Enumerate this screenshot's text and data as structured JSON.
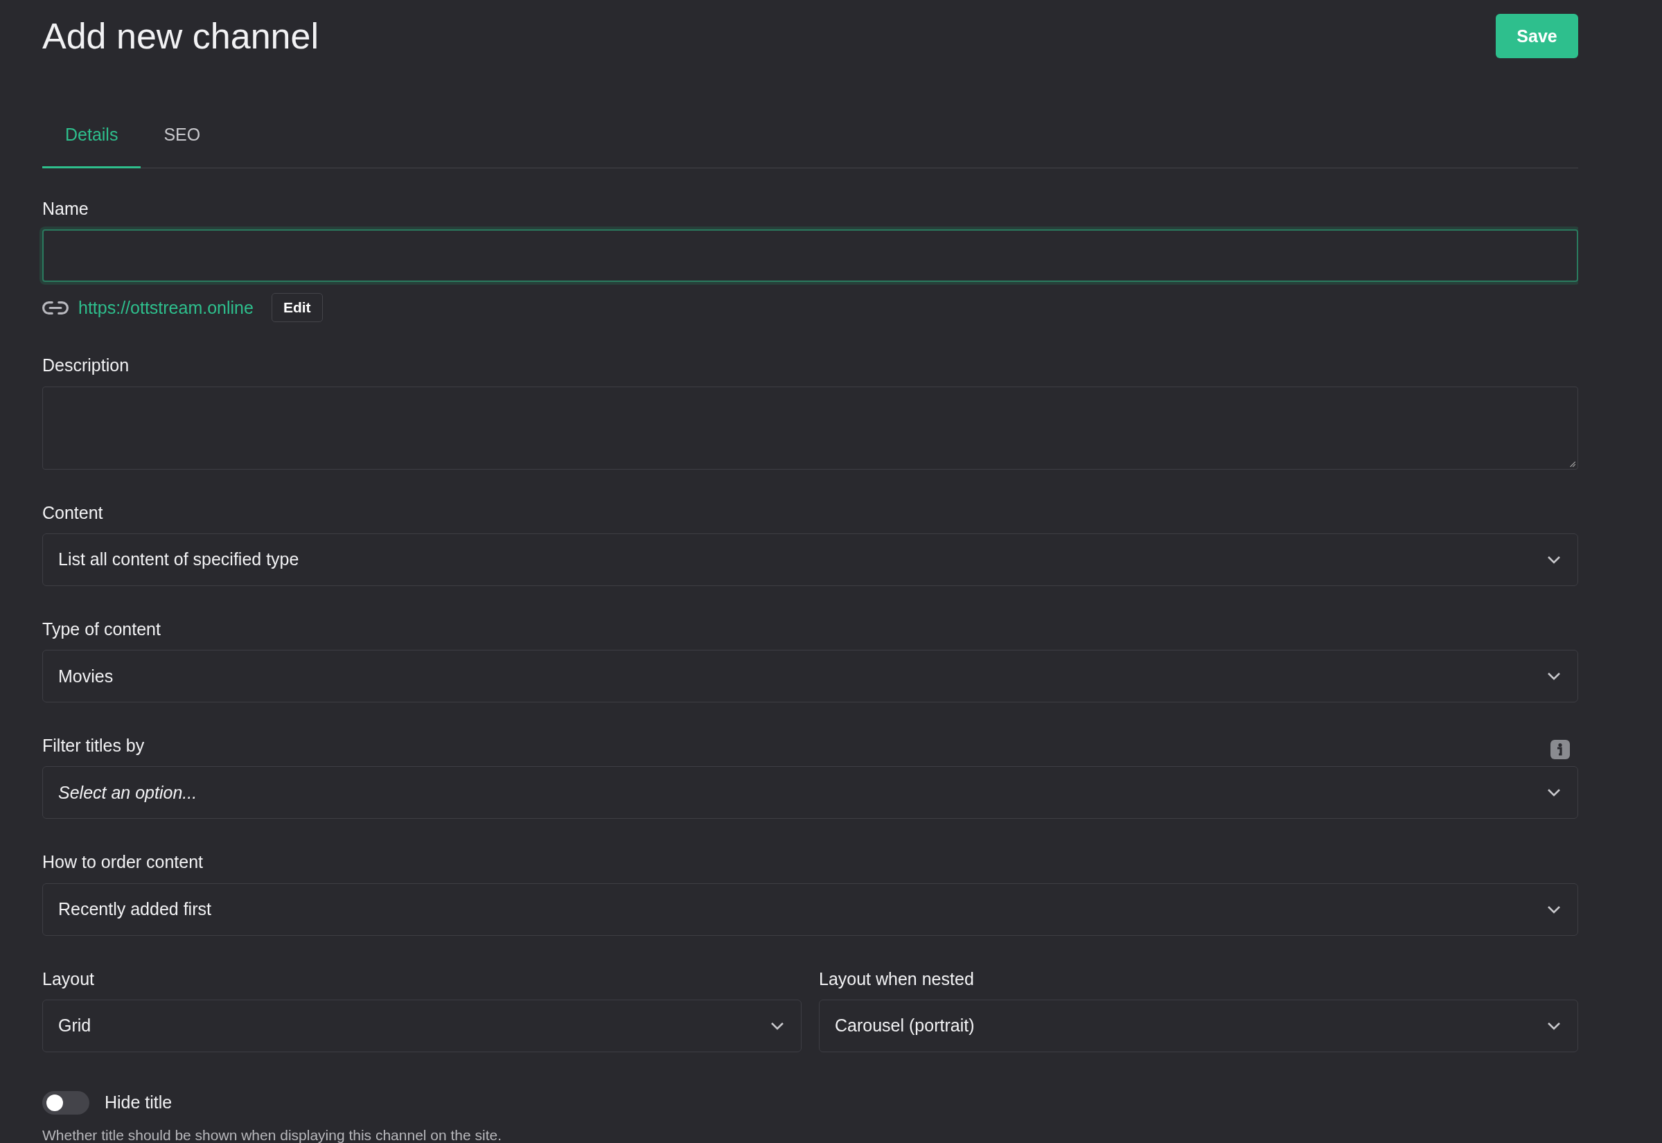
{
  "header": {
    "title": "Add new channel",
    "save_button": "Save"
  },
  "tabs": [
    {
      "label": "Details",
      "selected": true
    },
    {
      "label": "SEO",
      "selected": false
    }
  ],
  "fields": [
    {
      "kind": "text",
      "label": "Name",
      "focused": true,
      "link": {
        "url": "https://ottstream.online",
        "button": "Edit"
      }
    },
    {
      "kind": "textarea",
      "label": "Description"
    },
    {
      "kind": "select",
      "label": "Content",
      "value": "List all content of specified type"
    },
    {
      "kind": "select",
      "label": "Type of content",
      "value": "Movies"
    },
    {
      "kind": "select",
      "label": "Filter titles by",
      "placeholder": "Select an option...",
      "info": true
    },
    {
      "kind": "select",
      "label": "How to order content",
      "value": "Recently added first"
    },
    {
      "kind": "pair",
      "items": [
        {
          "label": "Layout",
          "value": "Grid"
        },
        {
          "label": "Layout when nested",
          "value": "Carousel (portrait)"
        }
      ]
    }
  ],
  "toggle": {
    "label": "Hide title",
    "on": false,
    "help": "Whether title should be shown when displaying this channel on the site."
  }
}
